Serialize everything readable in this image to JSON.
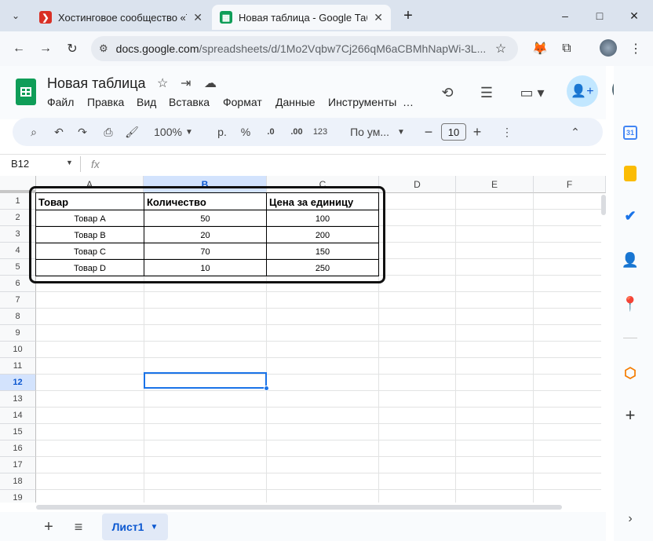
{
  "browser": {
    "tabs": [
      {
        "title": "Хостинговое сообщество «Tim",
        "favicon_color": "#d93025",
        "favicon_glyph": "❯"
      },
      {
        "title": "Новая таблица - Google Табли",
        "favicon_color": "#0f9d58",
        "favicon_glyph": "▦"
      }
    ],
    "new_tab": "+",
    "window": {
      "minimize": "–",
      "maximize": "□",
      "close": "✕",
      "chevron": "⌄"
    },
    "address": {
      "host": "docs.google.com",
      "path": "/spreadsheets/d/1Mo2Vqbw7Cj266qM6aCBMhNapWi-3L..."
    }
  },
  "doc": {
    "title": "Новая таблица",
    "menus": [
      "Файл",
      "Правка",
      "Вид",
      "Вставка",
      "Формат",
      "Данные",
      "Инструменты",
      "…"
    ]
  },
  "toolbar": {
    "zoom": "100%",
    "currency": "р.",
    "percent": "%",
    "dec_minus": ".0",
    "dec_plus": ".00",
    "number_format": "123",
    "font": "По ум...",
    "font_size": "10"
  },
  "formula_bar": {
    "name_box": "B12",
    "fx": "fx"
  },
  "grid": {
    "columns": [
      "A",
      "B",
      "C",
      "D",
      "E",
      "F"
    ],
    "rows": [
      "1",
      "2",
      "3",
      "4",
      "5",
      "6",
      "7",
      "8",
      "9",
      "10",
      "11",
      "12",
      "13",
      "14",
      "15",
      "16",
      "17",
      "18",
      "19"
    ],
    "selected_row": "12",
    "selected_col": "B",
    "table": {
      "headers": [
        "Товар",
        "Количество",
        "Цена за единицу"
      ],
      "rows": [
        [
          "Товар A",
          "50",
          "100"
        ],
        [
          "Товар B",
          "20",
          "200"
        ],
        [
          "Товар C",
          "70",
          "150"
        ],
        [
          "Товар D",
          "10",
          "250"
        ]
      ]
    }
  },
  "sheets": {
    "add": "+",
    "list": "≡",
    "active": "Лист1"
  },
  "colors": {
    "accent": "#1a73e8",
    "sheets_green": "#0f9d58",
    "share_bg": "#c2e7ff"
  }
}
